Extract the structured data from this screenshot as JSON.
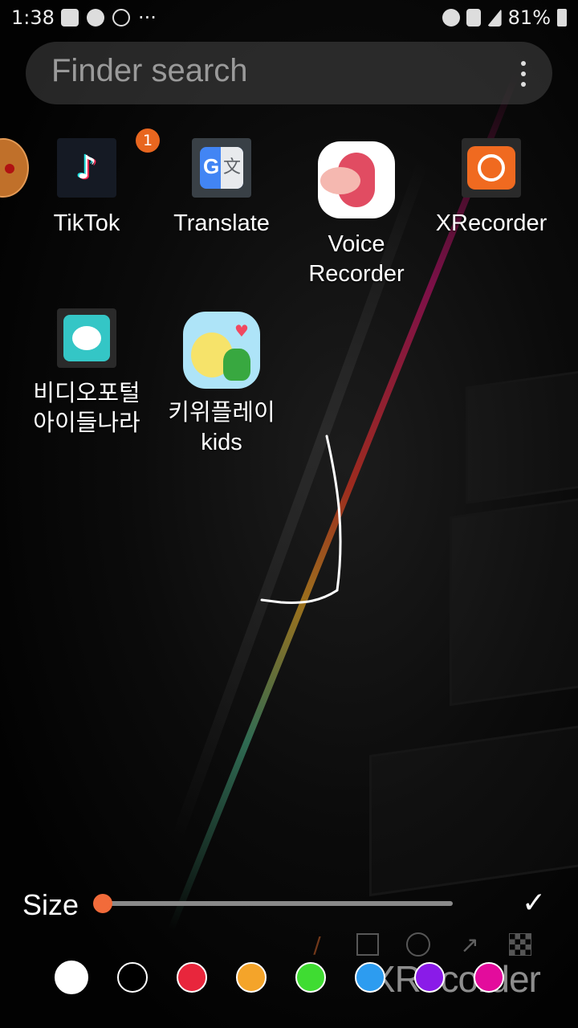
{
  "status_bar": {
    "time": "1:38",
    "battery": "81%",
    "more": "···"
  },
  "search": {
    "placeholder": "Finder search"
  },
  "apps": [
    {
      "name": "TikTok",
      "badge": "1"
    },
    {
      "name": "Translate"
    },
    {
      "name": "Voice\nRecorder"
    },
    {
      "name": "XRecorder"
    },
    {
      "name": "비디오포털\n아이들나라"
    },
    {
      "name": "키위플레이\nkids"
    }
  ],
  "toolbar": {
    "size_label": "Size",
    "size_value": 0,
    "colors": [
      "#ffffff",
      "#000000",
      "#e8263c",
      "#f4a42a",
      "#3fdc32",
      "#2d9cf0",
      "#8a1be8",
      "#e30c9c"
    ],
    "selected_color": "#ffffff"
  },
  "watermark": "XRecorder"
}
